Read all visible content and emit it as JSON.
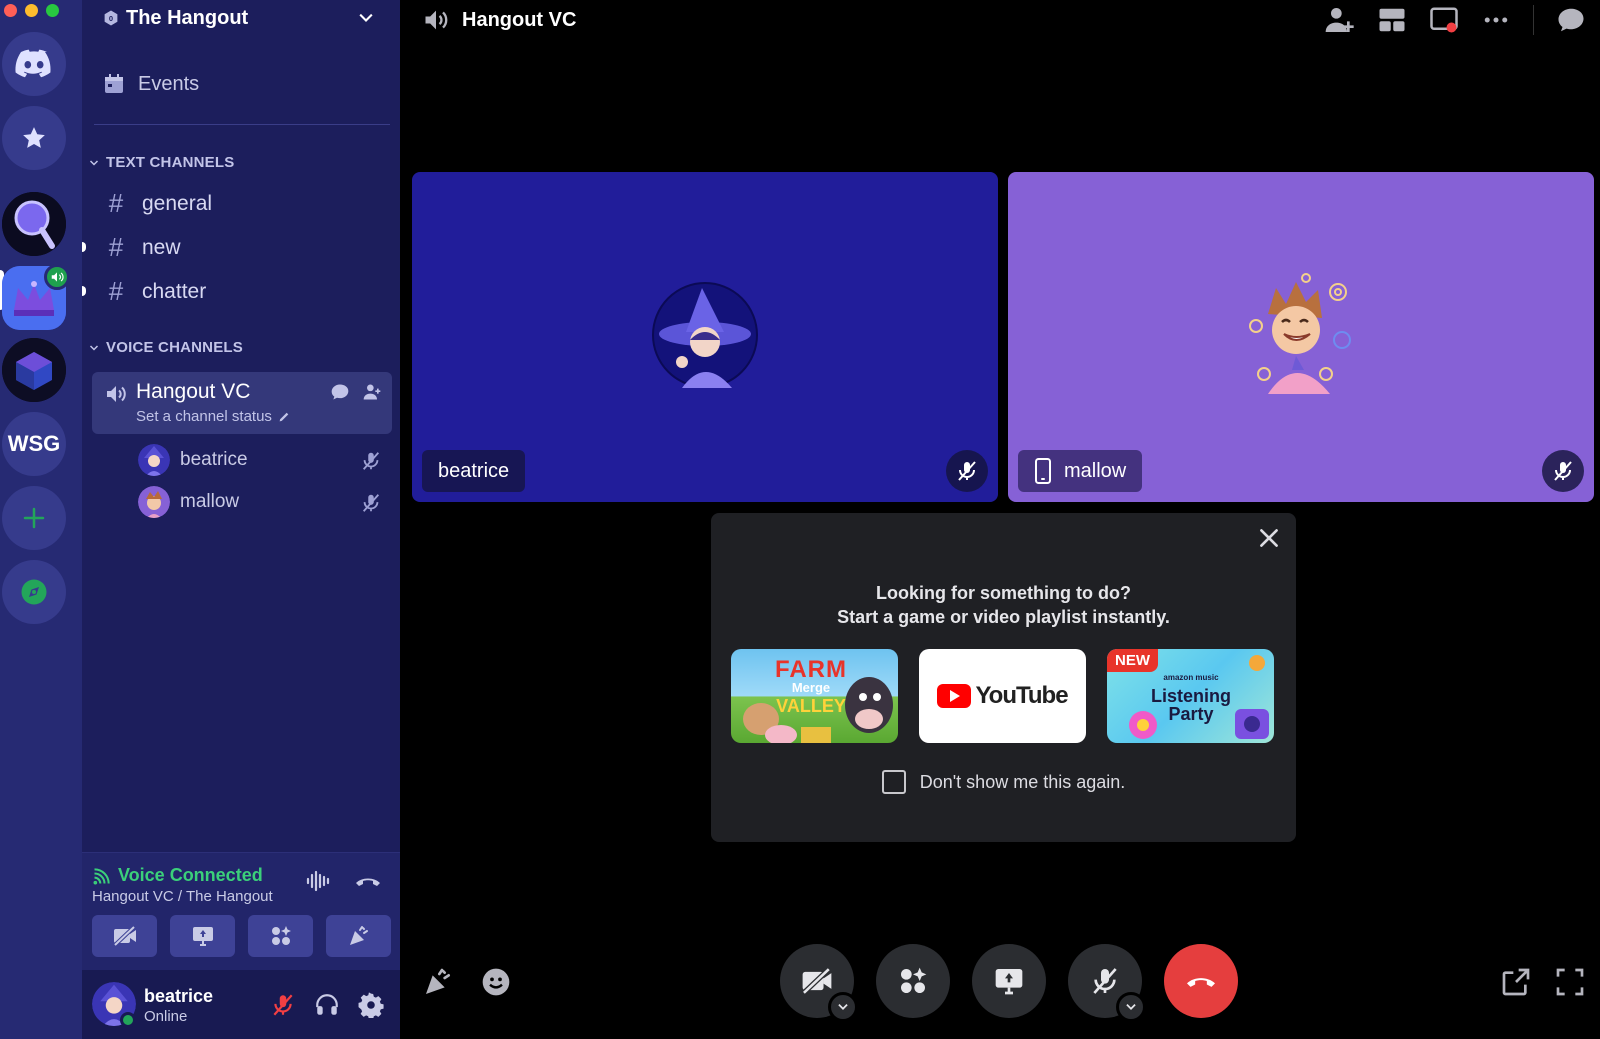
{
  "window": {
    "traffic_colors": [
      "#ff5f57",
      "#febc2e",
      "#28c840"
    ]
  },
  "server_rail": {
    "items": [
      {
        "name": "discord-home",
        "icon": "discord-logo-icon"
      },
      {
        "name": "favorites",
        "icon": "star-icon"
      },
      {
        "name": "server-magnifier",
        "icon": "magnifier-avatar"
      },
      {
        "name": "server-crown",
        "icon": "crown-avatar",
        "voice_active": true
      },
      {
        "name": "server-cube",
        "icon": "cube-avatar"
      },
      {
        "name": "server-wsg",
        "label": "WSG"
      },
      {
        "name": "add-server",
        "icon": "plus-icon"
      },
      {
        "name": "discover",
        "icon": "compass-icon"
      }
    ]
  },
  "sidebar": {
    "server_name": "The Hangout",
    "events_label": "Events",
    "text_category": "TEXT CHANNELS",
    "text_channels": [
      {
        "name": "general",
        "unread": false
      },
      {
        "name": "new",
        "unread": true
      },
      {
        "name": "chatter",
        "unread": true
      }
    ],
    "voice_category": "VOICE CHANNELS",
    "voice_channel": {
      "name": "Hangout VC",
      "status_placeholder": "Set a channel status",
      "members": [
        {
          "name": "beatrice",
          "muted": true
        },
        {
          "name": "mallow",
          "muted": true
        }
      ]
    },
    "voice_panel": {
      "status": "Voice Connected",
      "location": "Hangout VC / The Hangout"
    },
    "user": {
      "name": "beatrice",
      "status": "Online"
    }
  },
  "main": {
    "title": "Hangout VC",
    "tiles": [
      {
        "name": "beatrice",
        "bg": "#211d9a"
      },
      {
        "name": "mallow",
        "bg": "#8661d6",
        "mobile": true
      }
    ],
    "popup": {
      "line1": "Looking for something to do?",
      "line2": "Start a game or video playlist instantly.",
      "activities": [
        {
          "name": "Farm Merge Valley",
          "line1": "FARM",
          "line2": "Merge",
          "line3": "VALLEY"
        },
        {
          "name": "YouTube",
          "label": "YouTube"
        },
        {
          "name": "Listening Party",
          "badge": "NEW",
          "sub": "amazon music",
          "label1": "Listening",
          "label2": "Party"
        }
      ],
      "dont_show": "Don't show me this again."
    }
  },
  "colors": {
    "rail": "#262a73",
    "sidebar": "#1c1e5c",
    "accent_green": "#3bd07a",
    "hangup_red": "#e53e3e"
  }
}
